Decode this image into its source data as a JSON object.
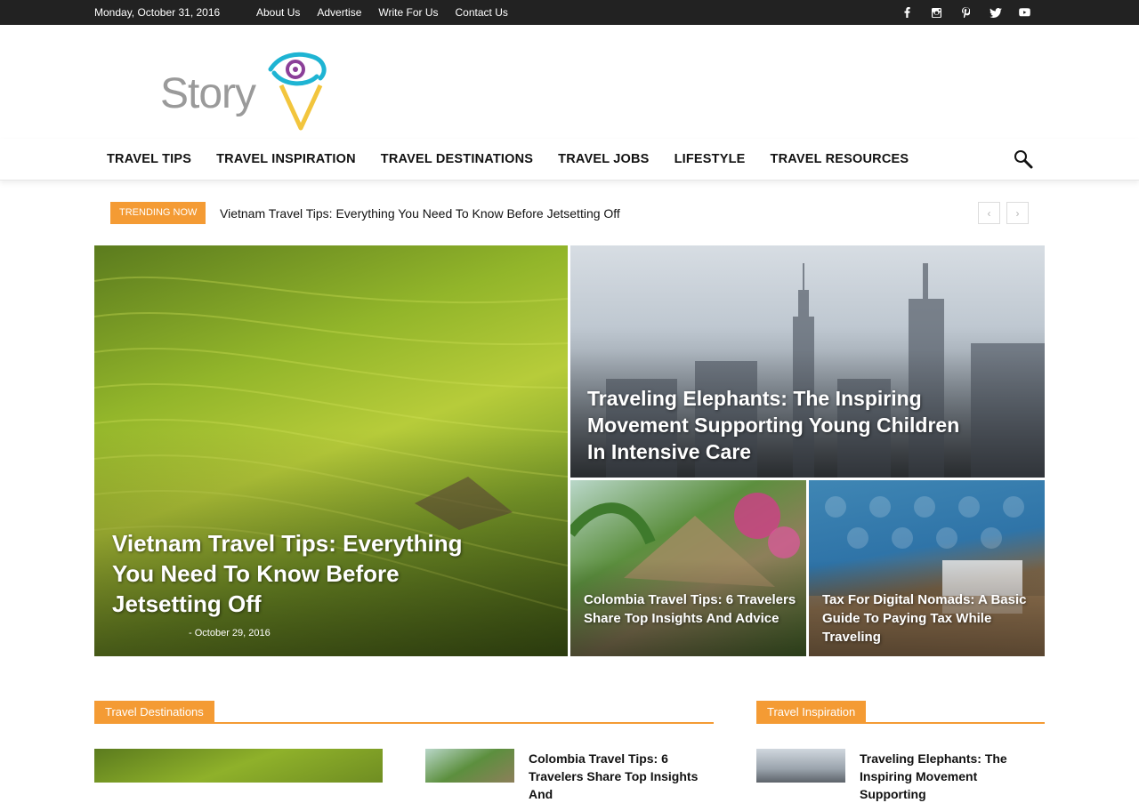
{
  "topbar": {
    "date": "Monday, October 31, 2016",
    "links": [
      "About Us",
      "Advertise",
      "Write For Us",
      "Contact Us"
    ],
    "social_icons": [
      "facebook-icon",
      "instagram-icon",
      "pinterest-icon",
      "twitter-icon",
      "youtube-icon"
    ]
  },
  "logo": {
    "text": "Story"
  },
  "nav": {
    "items": [
      "TRAVEL TIPS",
      "TRAVEL INSPIRATION",
      "TRAVEL DESTINATIONS",
      "TRAVEL JOBS",
      "LIFESTYLE",
      "TRAVEL RESOURCES"
    ]
  },
  "trending": {
    "label": "TRENDING NOW",
    "title": "Vietnam Travel Tips: Everything You Need To Know Before Jetsetting Off"
  },
  "featured": {
    "main": {
      "title": "Vietnam Travel Tips: Everything You Need To Know Before Jetsetting Off",
      "date": "October 29, 2016"
    },
    "top_right": {
      "title": "Traveling Elephants: The Inspiring Movement Supporting Young Children In Intensive Care"
    },
    "bottom_left": {
      "title": "Colombia Travel Tips: 6 Travelers Share Top Insights And Advice"
    },
    "bottom_right": {
      "title": "Tax For Digital Nomads: A Basic Guide To Paying Tax While Traveling"
    }
  },
  "sections": {
    "destinations": {
      "heading": "Travel Destinations",
      "item_title": "Colombia Travel Tips: 6 Travelers Share Top Insights And"
    },
    "inspiration": {
      "heading": "Travel Inspiration",
      "item_title": "Traveling Elephants: The Inspiring Movement Supporting"
    }
  },
  "colors": {
    "accent": "#f49b34",
    "topbar": "#222222",
    "logo_cyan": "#1eb4d3",
    "logo_yellow": "#f2c53d",
    "logo_purple": "#8b3f98"
  }
}
